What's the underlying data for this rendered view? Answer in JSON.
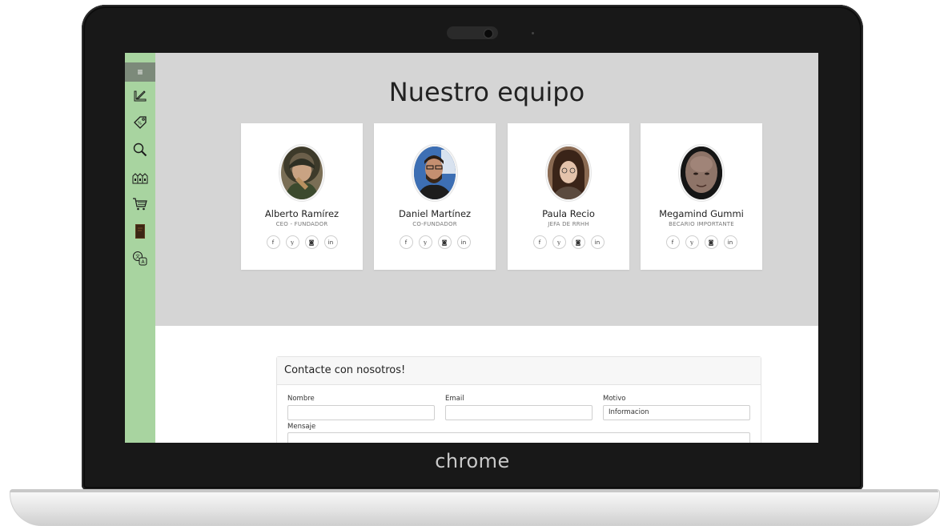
{
  "device": {
    "brand": "chrome"
  },
  "sidebar": {
    "toggle_glyph": "≡",
    "icons": [
      "ruler-pencil-icon",
      "price-tag-icon",
      "magnifier-icon",
      "houses-icon",
      "shopping-cart-icon",
      "book-icon",
      "translate-icon"
    ]
  },
  "team": {
    "title": "Nuestro equipo",
    "members": [
      {
        "name": "Alberto Ramírez",
        "role": "CEO - FUNDADOR"
      },
      {
        "name": "Daniel Martínez",
        "role": "CO-FUNDADOR"
      },
      {
        "name": "Paula Recio",
        "role": "JEFA DE RRHH"
      },
      {
        "name": "Megamind Gummi",
        "role": "BECARIO IMPORTANTE"
      }
    ],
    "social_glyphs": [
      "f",
      "𝕪",
      "◙",
      "in"
    ]
  },
  "contact": {
    "title": "Contacte con nosotros!",
    "name_label": "Nombre",
    "email_label": "Email",
    "reason_label": "Motivo",
    "reason_value": "Informacion",
    "message_label": "Mensaje"
  },
  "colors": {
    "sidebar": "#a8d4a0",
    "team_bg": "#d5d5d5",
    "laptop_bezel": "#181818"
  }
}
